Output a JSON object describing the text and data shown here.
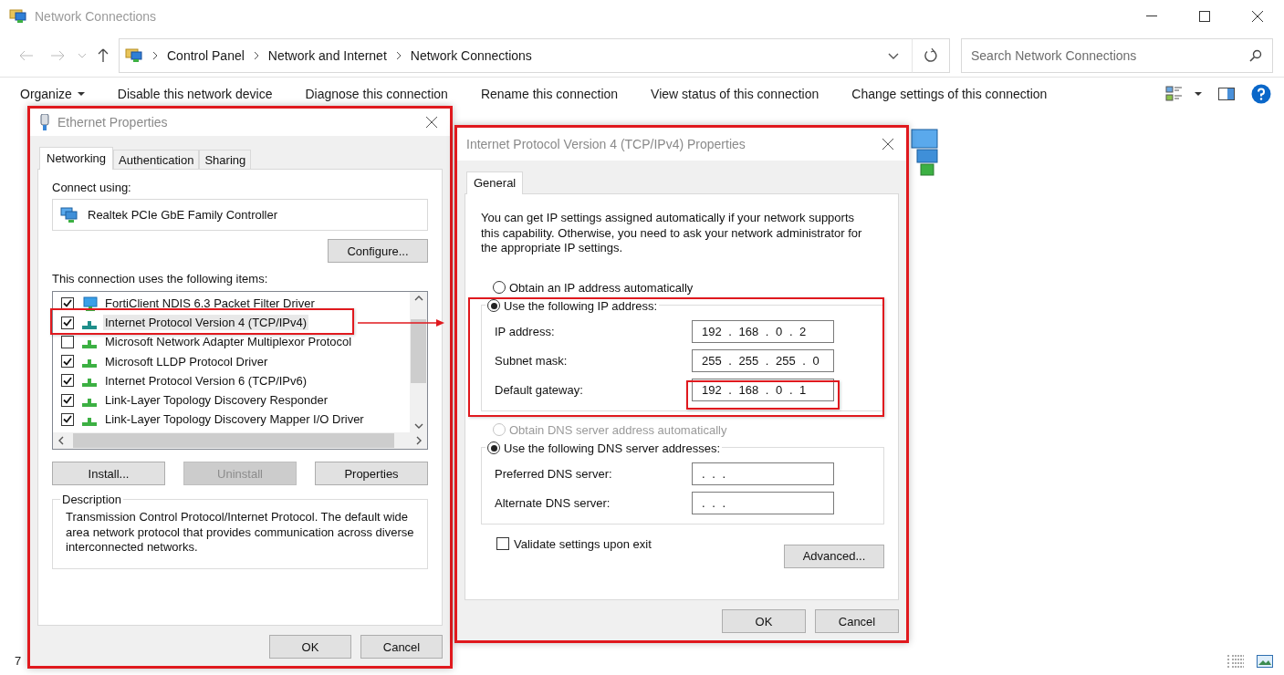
{
  "window": {
    "title": "Network Connections"
  },
  "address_bar": {
    "path": [
      "Control Panel",
      "Network and Internet",
      "Network Connections"
    ]
  },
  "search": {
    "placeholder": "Search Network Connections"
  },
  "toolbar": {
    "items": [
      {
        "label": "Organize",
        "dropdown": true
      },
      {
        "label": "Disable this network device",
        "dropdown": false
      },
      {
        "label": "Diagnose this connection",
        "dropdown": false
      },
      {
        "label": "Rename this connection",
        "dropdown": false
      },
      {
        "label": "View status of this connection",
        "dropdown": false
      },
      {
        "label": "Change settings of this connection",
        "dropdown": false
      }
    ]
  },
  "status_bar": {
    "count": "7"
  },
  "ethernet_properties": {
    "title": "Ethernet Properties",
    "tabs": [
      {
        "label": "Networking",
        "selected": true
      },
      {
        "label": "Authentication",
        "selected": false
      },
      {
        "label": "Sharing",
        "selected": false
      }
    ],
    "connect_using_label": "Connect using:",
    "adapter": "Realtek PCIe GbE Family Controller",
    "configure_button": "Configure...",
    "items_label": "This connection uses the following items:",
    "items": [
      {
        "label": "FortiClient NDIS 6.3 Packet Filter Driver",
        "kind": "service",
        "checked": true,
        "selected": false
      },
      {
        "label": "Internet Protocol Version 4 (TCP/IPv4)",
        "kind": "protocol",
        "checked": true,
        "selected": true
      },
      {
        "label": "Microsoft Network Adapter Multiplexor Protocol",
        "kind": "protocol",
        "checked": false,
        "selected": false
      },
      {
        "label": "Microsoft LLDP Protocol Driver",
        "kind": "protocol",
        "checked": true,
        "selected": false
      },
      {
        "label": "Internet Protocol Version 6 (TCP/IPv6)",
        "kind": "protocol",
        "checked": true,
        "selected": false
      },
      {
        "label": "Link-Layer Topology Discovery Responder",
        "kind": "protocol",
        "checked": true,
        "selected": false
      },
      {
        "label": "Link-Layer Topology Discovery Mapper I/O Driver",
        "kind": "protocol",
        "checked": true,
        "selected": false
      }
    ],
    "actions": [
      {
        "label": "Install...",
        "disabled": false
      },
      {
        "label": "Uninstall",
        "disabled": true
      },
      {
        "label": "Properties",
        "disabled": false
      }
    ],
    "description": {
      "label": "Description",
      "text": "Transmission Control Protocol/Internet Protocol. The default wide area network protocol that provides communication across diverse interconnected networks."
    },
    "buttons": [
      "OK",
      "Cancel"
    ]
  },
  "ipv4_properties": {
    "title": "Internet Protocol Version 4 (TCP/IPv4) Properties",
    "tabs": [
      {
        "label": "General",
        "selected": true
      }
    ],
    "intro": "You can get IP settings assigned automatically if your network supports this capability. Otherwise, you need to ask your network administrator for the appropriate IP settings.",
    "ip_options": [
      {
        "label": "Obtain an IP address automatically",
        "selected": false,
        "disabled": false
      },
      {
        "label": "Use the following IP address:",
        "selected": true,
        "disabled": false
      }
    ],
    "ip_fields": [
      {
        "label": "IP address:",
        "value": "192 . 168 . 0 . 2"
      },
      {
        "label": "Subnet mask:",
        "value": "255 . 255 . 255 . 0"
      },
      {
        "label": "Default gateway:",
        "value": "192 . 168 . 0 . 1"
      }
    ],
    "dns_options": [
      {
        "label": "Obtain DNS server address automatically",
        "selected": false,
        "disabled": true
      },
      {
        "label": "Use the following DNS server addresses:",
        "selected": true,
        "disabled": false
      }
    ],
    "dns_fields": [
      {
        "label": "Preferred DNS server:",
        "value": ". . ."
      },
      {
        "label": "Alternate DNS server:",
        "value": ". . ."
      }
    ],
    "validate": {
      "label": "Validate settings upon exit",
      "checked": false
    },
    "advanced_button": "Advanced...",
    "buttons": [
      "OK",
      "Cancel"
    ]
  }
}
